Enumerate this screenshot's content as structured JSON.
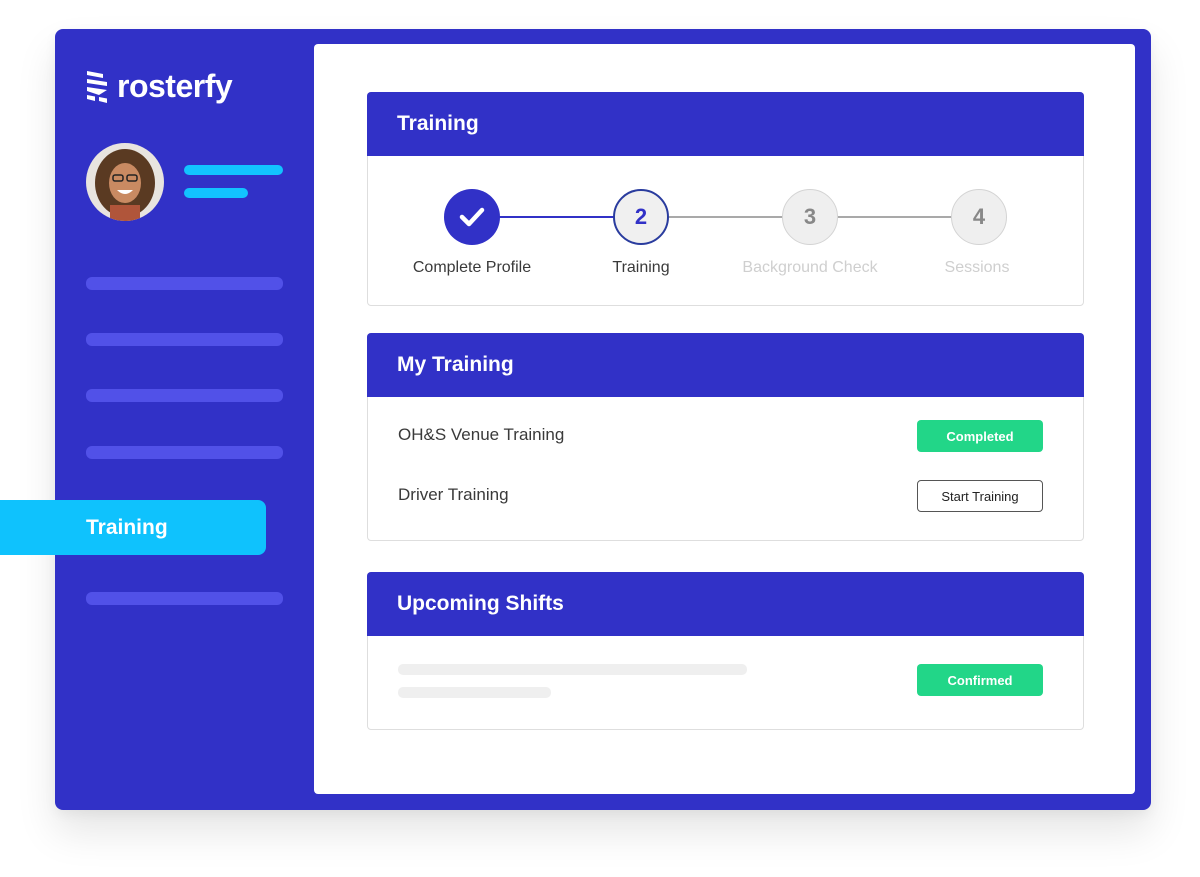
{
  "app": {
    "logo_text": "rosterfy"
  },
  "sidebar": {
    "active_item": {
      "label": "Training"
    },
    "accent_color": "#0fc2fd",
    "bg_color": "#3131c7"
  },
  "training_card": {
    "title": "Training",
    "steps": [
      {
        "number": "✓",
        "label": "Complete Profile",
        "state": "completed"
      },
      {
        "number": "2",
        "label": "Training",
        "state": "current"
      },
      {
        "number": "3",
        "label": "Background Check",
        "state": "upcoming"
      },
      {
        "number": "4",
        "label": "Sessions",
        "state": "upcoming"
      }
    ]
  },
  "my_training": {
    "title": "My Training",
    "items": [
      {
        "name": "OH&S Venue Training",
        "action": "Completed",
        "status": "completed"
      },
      {
        "name": "Driver Training",
        "action": "Start Training",
        "status": "not-started"
      }
    ]
  },
  "upcoming_shifts": {
    "title": "Upcoming Shifts",
    "items": [
      {
        "status": "Confirmed"
      }
    ]
  },
  "colors": {
    "primary": "#3131c7",
    "success": "#22d688",
    "cyan": "#12c3ff"
  }
}
